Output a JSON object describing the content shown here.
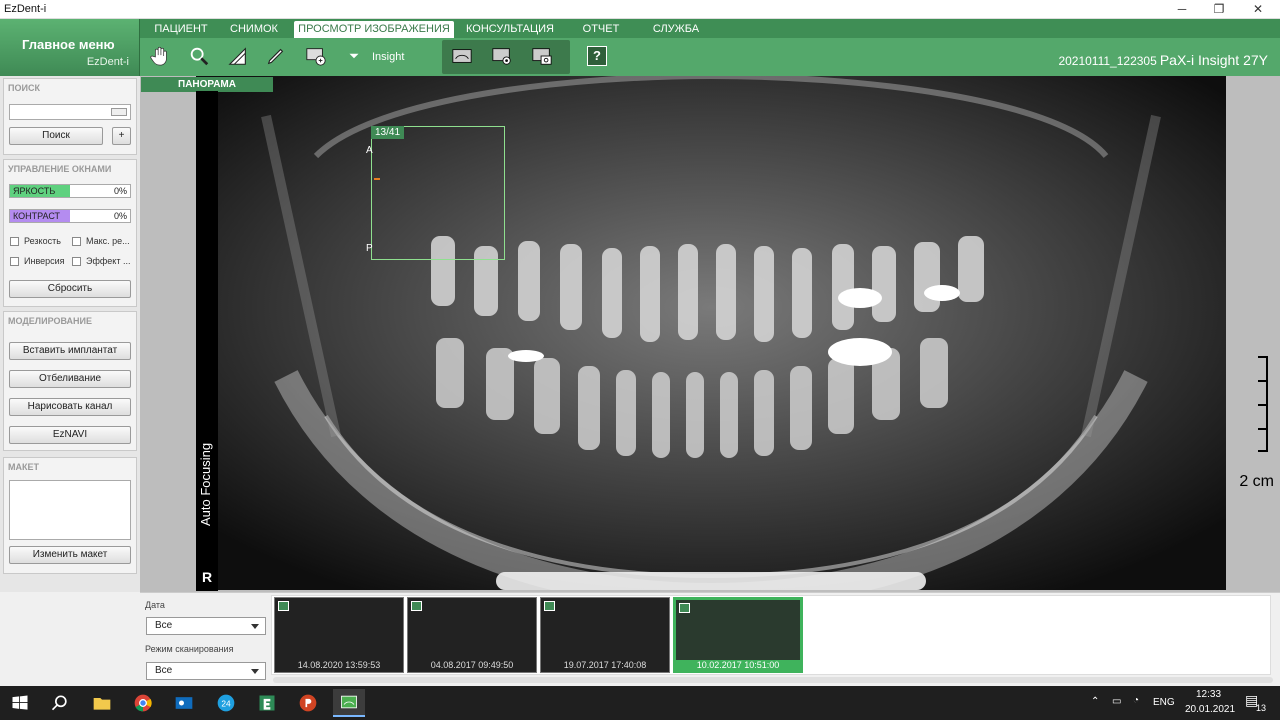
{
  "window": {
    "title": "EzDent-i",
    "minimize": "─",
    "maximize": "❐",
    "close": "✕"
  },
  "main_menu": {
    "title": "Главное меню",
    "subtitle": "EzDent-i"
  },
  "tabs": [
    {
      "label": "ПАЦИЕНТ"
    },
    {
      "label": "СНИМОК"
    },
    {
      "label": "ПРОСМОТР ИЗОБРАЖЕНИЯ"
    },
    {
      "label": "КОНСУЛЬТАЦИЯ"
    },
    {
      "label": "ОТЧЕТ"
    },
    {
      "label": "СЛУЖБА"
    }
  ],
  "toolbar": {
    "insight_label": "Insight",
    "help": "?"
  },
  "scan_info": {
    "id": "20210111_122305",
    "device": "PaX-i Insight 27Y"
  },
  "search_panel": {
    "title": "ПОИСК",
    "search_value": "",
    "search_button": "Поиск",
    "add_button": "+"
  },
  "window_panel": {
    "title": "УПРАВЛЕНИЕ ОКНАМИ",
    "brightness": {
      "label": "ЯРКОСТЬ",
      "value": "0%",
      "level": 0.5,
      "color": "#5fd17f"
    },
    "contrast": {
      "label": "КОНТРАСТ",
      "value": "0%",
      "level": 0.5,
      "color": "#b48cf0"
    },
    "checkboxes": [
      "Резкость",
      "Макс. ре...",
      "Инверсия",
      "Эффект ..."
    ],
    "reset_button": "Сбросить"
  },
  "modeling_panel": {
    "title": "МОДЕЛИРОВАНИЕ",
    "buttons": [
      "Вставить имплантат",
      "Отбеливание",
      "Нарисовать канал",
      "EzNAVI"
    ]
  },
  "layout_panel": {
    "title": "МАКЕТ",
    "change_button": "Изменить макет"
  },
  "viewer": {
    "tab": "ПАНОРАМА",
    "auto_focusing": "Auto Focusing",
    "r_marker": "R",
    "roi": {
      "label": "13/41",
      "top_label": "A",
      "bottom_label": "P"
    },
    "scale_label": "2 cm"
  },
  "filters": {
    "date_label": "Дата",
    "date_value": "Все",
    "mode_label": "Режим сканирования",
    "mode_value": "Все"
  },
  "thumbnails": [
    {
      "caption": "14.08.2020 13:59:53",
      "selected": false
    },
    {
      "caption": "04.08.2017 09:49:50",
      "selected": false
    },
    {
      "caption": "19.07.2017 17:40:08",
      "selected": false
    },
    {
      "caption": "10.02.2017 10:51:00",
      "selected": true
    }
  ],
  "taskbar": {
    "lang": "ENG",
    "time": "12:33",
    "date": "20.01.2021",
    "notifications": "13"
  }
}
